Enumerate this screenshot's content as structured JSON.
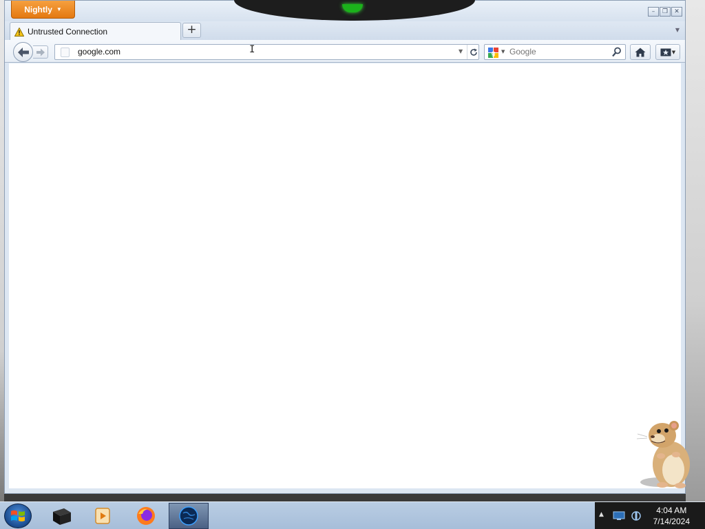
{
  "window": {
    "app_menu_label": "Nightly",
    "controls": {
      "minimize": "minimize-icon",
      "restore": "restore-icon",
      "close": "close-icon"
    }
  },
  "tabs": [
    {
      "title": "Untrusted Connection",
      "icon": "warning-icon",
      "active": true
    }
  ],
  "tabstrip": {
    "new_tab_label": "+"
  },
  "navbar": {
    "url": "google.com",
    "search_placeholder": "Google",
    "search_engine_icon": "google-icon"
  },
  "taskbar": {
    "items": [
      {
        "name": "terminal-app",
        "icon": "black-box-icon"
      },
      {
        "name": "media-player-app",
        "icon": "media-player-icon"
      },
      {
        "name": "firefox-app",
        "icon": "firefox-icon"
      },
      {
        "name": "nightly-app",
        "icon": "nightly-globe-icon",
        "active": true
      }
    ],
    "clock": {
      "time": "4:04 AM",
      "date": "7/14/2024"
    }
  },
  "colors": {
    "app_menu": "#e47911",
    "window_frame": "#dce6f2",
    "taskbar": "#a7bed9",
    "tray": "#1a1a1a"
  }
}
